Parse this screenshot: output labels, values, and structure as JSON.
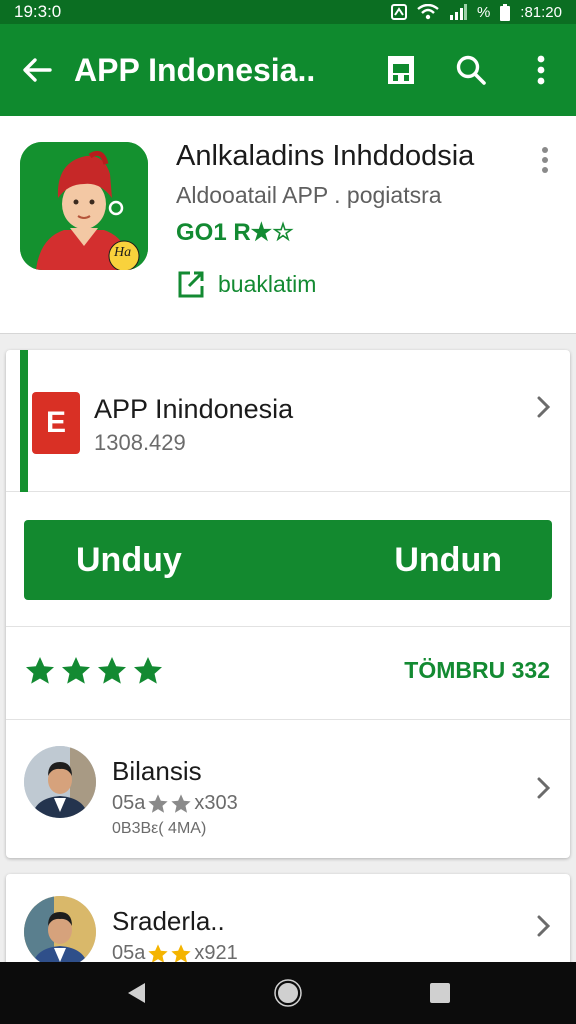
{
  "status": {
    "time": "19:3:0",
    "battery_text": "%",
    "clock_right": ":81:20"
  },
  "app_bar": {
    "title": "APP Indonesia..",
    "icons": [
      "back-arrow-icon",
      "store-icon",
      "search-icon",
      "more-vert-icon"
    ]
  },
  "header": {
    "title": "Anlkaladins Inhddodsia",
    "subtitle": "Aldooatail APP . pogiatsra",
    "rating_text": "GO1 R★☆",
    "update_label": "buaklatim",
    "icon_badge": "Ha"
  },
  "package": {
    "name": "APP Inindonesia",
    "count": "1308.429",
    "icon_letter": "E"
  },
  "download": {
    "left_label": "Unduy",
    "right_label": "Undun"
  },
  "rating": {
    "stars_filled": 4,
    "stars_total": 4,
    "label": "TÖMBRU 332"
  },
  "reviews": [
    {
      "name": "Bilansis",
      "meta_prefix": "05a",
      "meta_suffix": "x303",
      "date": "0B3Bε( 4MA)",
      "stars_filled": 2,
      "stars_total": 2,
      "star_color": "#8a8a8a"
    },
    {
      "name": "Sraderla..",
      "meta_prefix": "05a",
      "meta_suffix": "x921",
      "stars_filled": 2,
      "stars_total": 2,
      "star_color": "#f4b400"
    }
  ],
  "colors": {
    "primary": "#0f8a2e",
    "status_bar": "#0b6e22",
    "accent_text": "#138a32",
    "nav_bar": "#0c0c0c"
  }
}
